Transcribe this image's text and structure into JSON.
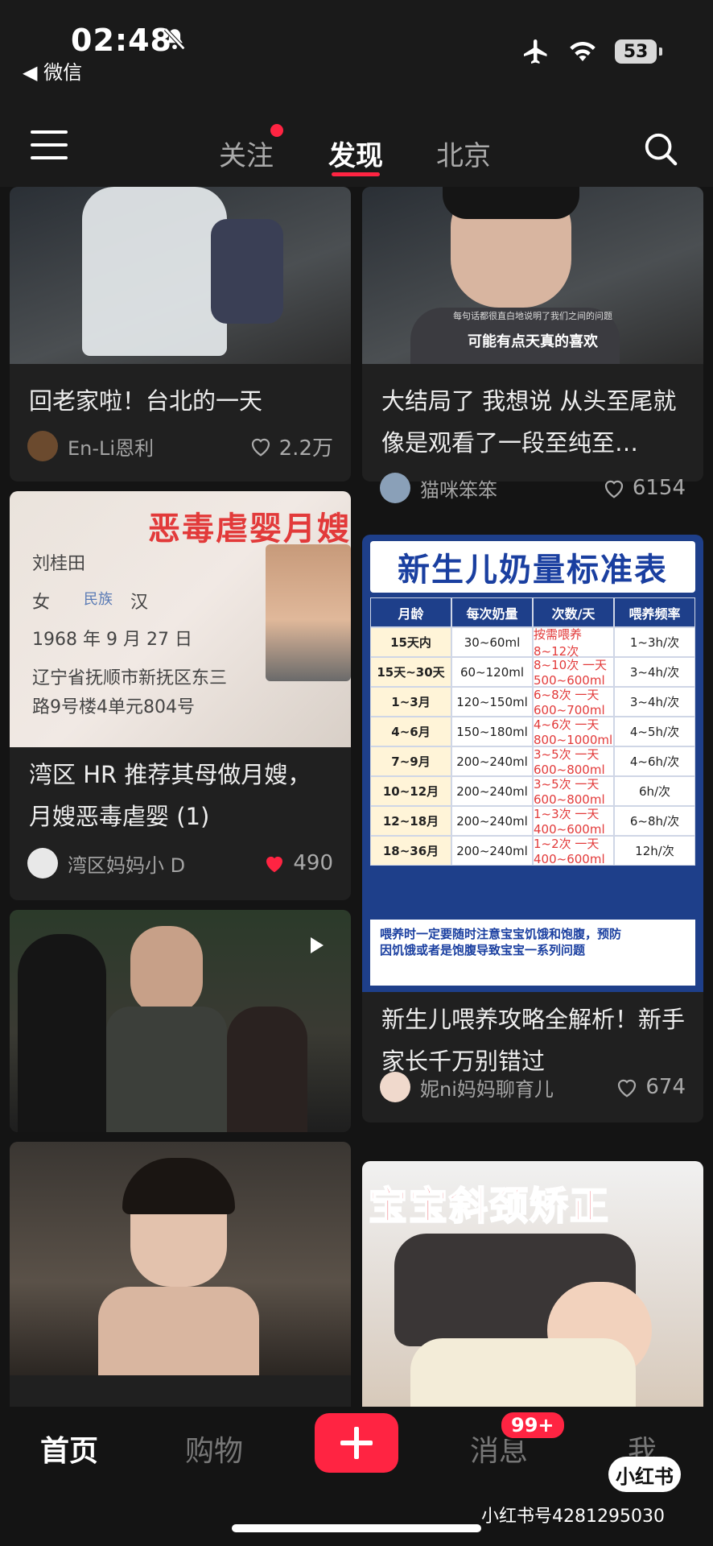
{
  "status_bar": {
    "time": "02:48",
    "back_app": "◀ 微信",
    "battery": "53"
  },
  "top_nav": {
    "tabs": [
      "关注",
      "发现",
      "北京"
    ],
    "active_tab": "发现"
  },
  "feed": {
    "left": [
      {
        "title": "回老家啦！台北的一天",
        "author": "En-Li恩利",
        "likes": "2.2万",
        "liked": false
      },
      {
        "title": "湾区 HR 推荐其母做月嫂，月嫂恶毒虐婴 (1)",
        "author": "湾区妈妈小 D",
        "likes": "490",
        "liked": true,
        "image_text": {
          "headline": "恶毒虐婴月嫂",
          "name": "刘桂田",
          "sex": "女",
          "ethnic_label": "民族",
          "ethnic": "汉",
          "birth": "1968 年 9 月 27 日",
          "address1": "辽宁省抚顺市新抚区东三",
          "address2": "路9号楼4单元804号"
        }
      },
      {
        "title": "",
        "author": "",
        "likes": ""
      },
      {
        "title": "",
        "author": "",
        "likes": ""
      }
    ],
    "right": [
      {
        "title": "大结局了 我想说 从头至尾就像是观看了一段至纯至…",
        "author": "猫咪笨笨",
        "likes": "6154",
        "liked": false,
        "image_text": {
          "subtitle_small": "每句话都很直白地说明了我们之间的问题",
          "subtitle": "可能有点天真的喜欢"
        }
      },
      {
        "title": "新生儿喂养攻略全解析！新手家长千万别错过",
        "author": "妮ni妈妈聊育儿",
        "likes": "674",
        "liked": false,
        "table": {
          "title": "新生儿奶量标准表",
          "headers": [
            "月龄",
            "每次奶量",
            "次数/天",
            "喂养频率"
          ],
          "rows": [
            [
              "15天内",
              "30~60ml",
              "按需喂养8~12次",
              "1~3h/次"
            ],
            [
              "15天~30天",
              "60~120ml",
              "8~10次 一天500~600ml",
              "3~4h/次"
            ],
            [
              "1~3月",
              "120~150ml",
              "6~8次 一天600~700ml",
              "3~4h/次"
            ],
            [
              "4~6月",
              "150~180ml",
              "4~6次 一天800~1000ml",
              "4~5h/次"
            ],
            [
              "7~9月",
              "200~240ml",
              "3~5次 一天600~800ml",
              "4~6h/次"
            ],
            [
              "10~12月",
              "200~240ml",
              "3~5次 一天600~800ml",
              "6h/次"
            ],
            [
              "12~18月",
              "200~240ml",
              "1~3次 一天400~600ml",
              "6~8h/次"
            ],
            [
              "18~36月",
              "200~240ml",
              "1~2次 一天400~600ml",
              "12h/次"
            ]
          ],
          "footer": "喂养时一定要随时注意宝宝饥饿和饱腹，预防因饥饿或者是饱腹导致宝宝一系列问题"
        }
      },
      {
        "title": "",
        "author": "",
        "likes": "",
        "image_text": {
          "headline": "宝宝斜颈矫正"
        }
      }
    ]
  },
  "tab_bar": {
    "items": [
      "首页",
      "购物",
      "消息",
      "我"
    ],
    "active": "首页",
    "badge": "99+"
  },
  "watermark": {
    "logo": "小红书",
    "text": "小红书号4281295030"
  },
  "colors": {
    "accent": "#ff2442",
    "background": "#141414",
    "card": "#202020"
  }
}
